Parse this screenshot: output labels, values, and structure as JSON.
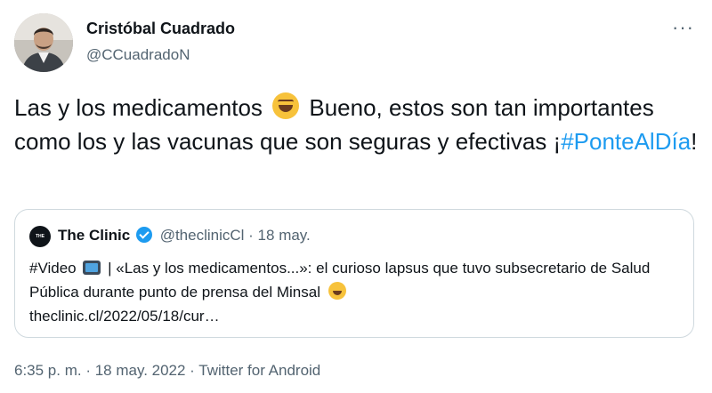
{
  "author": {
    "name": "Cristóbal Cuadrado",
    "handle": "@CCuadradoN"
  },
  "more_label": "···",
  "tweet": {
    "text_part1": "Las y los medicamentos",
    "emoji_1": "rolling-on-floor-laughing-icon",
    "text_part2": "Bueno, estos son tan importantes como los y las vacunas que son seguras y efectivas ¡",
    "hashtag": "#PonteAlDía",
    "text_part3": "!"
  },
  "quote": {
    "logo_text": "THE CLINIC",
    "name": "The Clinic",
    "handle": "@theclinicCl",
    "date": "· 18 may.",
    "body_part1": "#Video",
    "body_part2": "| «Las y los medicamentos...»: el curioso lapsus que tuvo subsecretario de Salud Pública durante punto de prensa del Minsal",
    "link": "theclinic.cl/2022/05/18/cur…"
  },
  "footer": "6:35 p. m. · 18 may. 2022 · Twitter for Android",
  "colors": {
    "accent": "#1d9bf0",
    "text": "#0f1419",
    "muted": "#536471",
    "border": "#cfd9de"
  }
}
